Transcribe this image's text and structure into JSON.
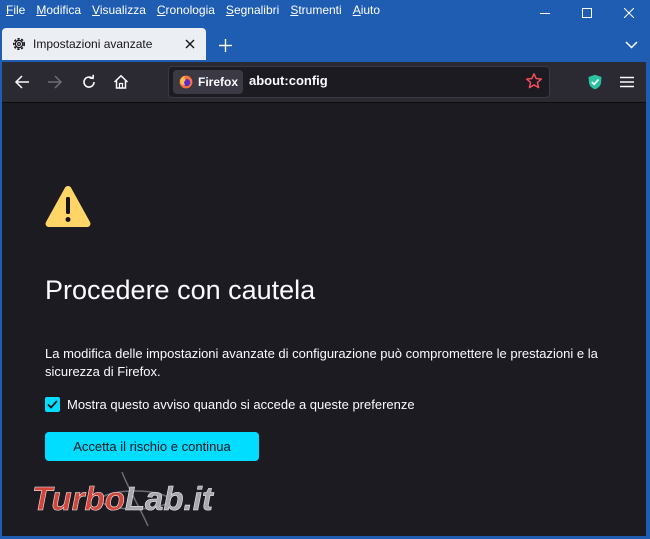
{
  "menu": {
    "file": "File",
    "modifica": "Modifica",
    "visualizza": "Visualizza",
    "cronologia": "Cronologia",
    "segnalibri": "Segnalibri",
    "strumenti": "Strumenti",
    "aiuto": "Aiuto"
  },
  "tab": {
    "title": "Impostazioni avanzate"
  },
  "urlbar": {
    "identity_label": "Firefox",
    "url": "about:config"
  },
  "page": {
    "heading": "Procedere con cautela",
    "description": "La modifica delle impostazioni avanzate di configurazione può compromettere le prestazioni e la sicurezza di Firefox.",
    "checkbox_label": "Mostra questo avviso quando si accede a queste preferenze",
    "checkbox_checked": true,
    "accept_button": "Accetta il rischio e continua"
  },
  "watermark": {
    "text": "TurboLab.it"
  },
  "icons": {
    "tab": "gear-icon",
    "back": "arrow-left-icon",
    "forward": "arrow-right-icon",
    "reload": "reload-icon",
    "home": "home-icon",
    "identity": "firefox-logo-icon",
    "bookmark": "star-icon",
    "extension": "shield-check-icon",
    "menu": "hamburger-icon",
    "warning": "warning-triangle-icon"
  },
  "colors": {
    "titlebar": "#1f5db3",
    "toolbar": "#2b2a33",
    "page_background": "#1c1b22",
    "accent": "#00ddff",
    "warning": "#ffd567",
    "text": "#fbfbfe",
    "bookmark_star": "#ff4f5e",
    "shield": "#2ac3a2"
  }
}
